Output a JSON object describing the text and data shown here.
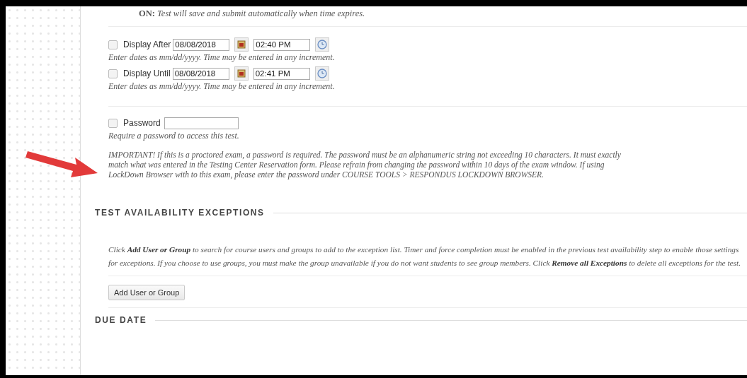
{
  "timer_note": "**ON:** *Test will save and submit automatically when time expires.*",
  "display_rows": [
    {
      "label": "Display After",
      "checked": false,
      "date": "08/08/2018",
      "time": "02:40 PM",
      "hint": "Enter dates as mm/dd/yyyy. Time may be entered in any increment."
    },
    {
      "label": "Display Until",
      "checked": false,
      "date": "08/08/2018",
      "time": "02:41 PM",
      "hint": "Enter dates as mm/dd/yyyy. Time may be entered in any increment."
    }
  ],
  "password": {
    "label": "Password",
    "checked": false,
    "hint": "Require a password to access this test.",
    "important": "IMPORTANT! If this is a proctored exam, a password is required. The password must be an alphanumeric string not exceeding 10 characters. It must exactly match what was entered in the Testing Center Reservation form. Please refrain from changing the password within 10 days of the exam window. If using LockDown Browser with to this exam, please enter the password under COURSE TOOLS > RESPONDUS LOCKDOWN BROWSER."
  },
  "exceptions": {
    "heading": "TEST AVAILABILITY EXCEPTIONS",
    "text": "*Click* **Add User or Group** *to search for course users and groups to add to the exception list. Timer and force completion must be enabled in the previous test availability step to enable those settings for exceptions. If you choose to use groups, you must make the group unavailable if you do not want students to see group members. Click* **Remove all Exceptions** *to delete all exceptions for the test.*",
    "button": "Add User or Group"
  },
  "next_section": {
    "heading": "DUE DATE"
  }
}
